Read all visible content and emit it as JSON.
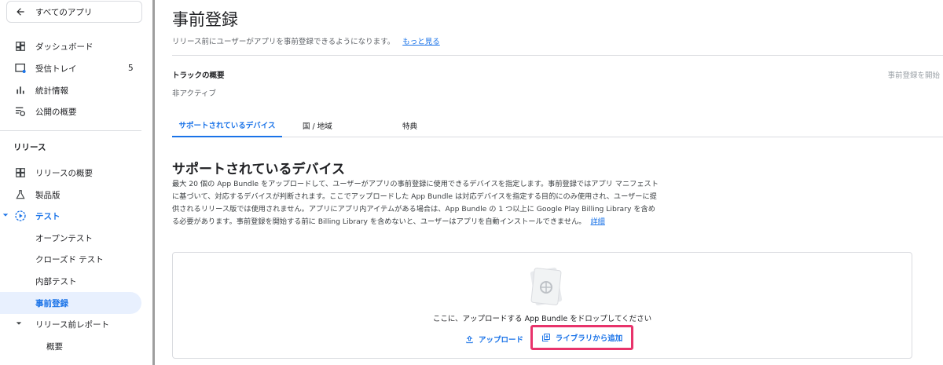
{
  "sidebar": {
    "back_label": "すべてのアプリ",
    "items": [
      {
        "label": "ダッシュボード",
        "icon": "dashboard-icon"
      },
      {
        "label": "受信トレイ",
        "icon": "inbox-icon",
        "count": "5"
      },
      {
        "label": "統計情報",
        "icon": "bar-chart-icon"
      },
      {
        "label": "公開の概要",
        "icon": "publishing-overview-icon"
      }
    ],
    "section_label": "リリース",
    "release_items": [
      {
        "label": "リリースの概要",
        "icon": "release-overview-icon"
      },
      {
        "label": "製品版",
        "icon": "production-icon"
      },
      {
        "label": "テスト",
        "icon": "testing-icon"
      },
      {
        "label": "オープンテスト"
      },
      {
        "label": "クローズド テスト"
      },
      {
        "label": "内部テスト"
      },
      {
        "label": "事前登録"
      },
      {
        "label": "リリース前レポート"
      },
      {
        "label": "概要"
      }
    ]
  },
  "main": {
    "title": "事前登録",
    "subtitle": "リリース前にユーザーがアプリを事前登録できるようになります。",
    "learn_more": "もっと見る",
    "track_title": "トラックの概要",
    "track_status": "非アクティブ",
    "start_button": "事前登録を開始",
    "tabs": [
      "サポートされているデバイス",
      "国 / 地域",
      "特典"
    ],
    "section_title": "サポートされているデバイス",
    "description": "最大 20 個の App Bundle をアップロードして、ユーザーがアプリの事前登録に使用できるデバイスを指定します。事前登録ではアプリ マニフェストに基づいて、対応するデバイスが判断されます。ここでアップロードした App Bundle は対応デバイスを指定する目的にのみ使用され、ユーザーに提供されるリリース版では使用されません。アプリにアプリ内アイテムがある場合は、App Bundle の 1 つ以上に Google Play Billing Library を含める必要があります。事前登録を開始する前に Billing Library を含めないと、ユーザーはアプリを自動インストールできません。",
    "details_link": "詳細",
    "drop_text": "ここに、アップロードする App Bundle をドロップしてください",
    "upload_label": "アップロード",
    "library_label": "ライブラリから追加"
  },
  "colors": {
    "accent": "#1a73e8",
    "highlight_box": "#e8336b"
  }
}
